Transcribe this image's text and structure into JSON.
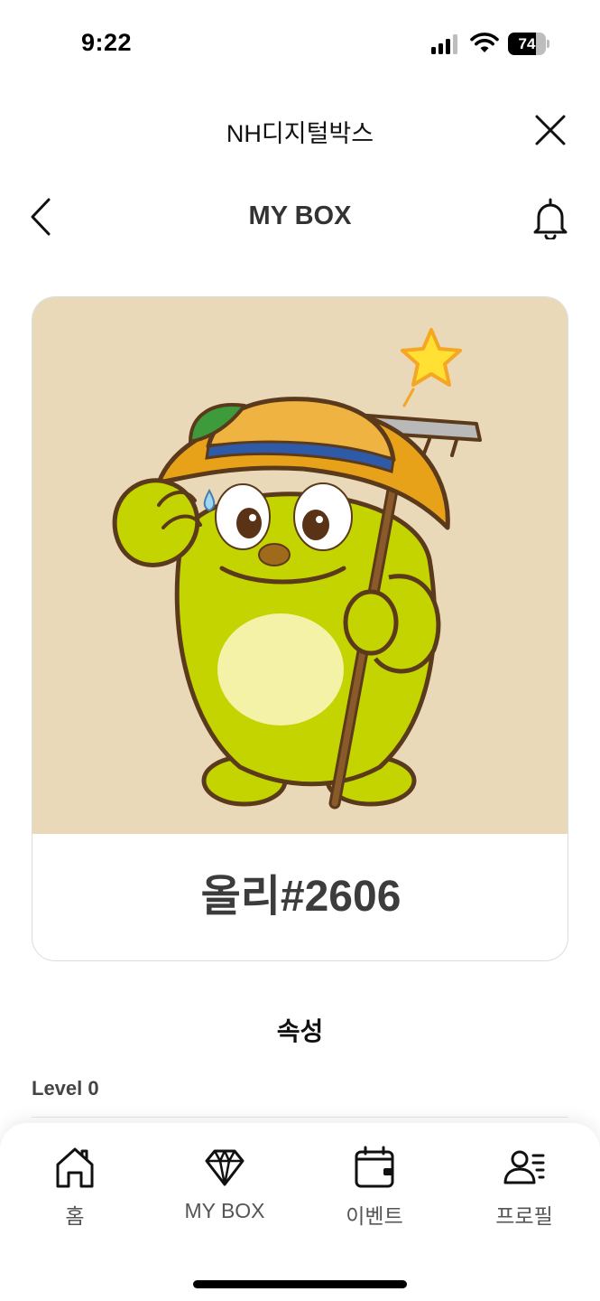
{
  "status_bar": {
    "time": "9:22",
    "battery": "74",
    "battery_level": 0.74,
    "icons": [
      "signal-icon",
      "wifi-icon",
      "battery-icon"
    ]
  },
  "browser_header": {
    "title": "NH디지털박스",
    "close_icon": "close-icon"
  },
  "page_header": {
    "title": "MY BOX",
    "back_icon": "chevron-left-icon",
    "notification_icon": "bell-icon"
  },
  "nft": {
    "name": "올리#2606",
    "image_background": "#e9d9b8",
    "image_description_icon": "olly-character-image"
  },
  "attributes": {
    "title": "속성",
    "level_label": "Level 0"
  },
  "bottom_nav": {
    "items": [
      {
        "label": "홈",
        "icon": "home-icon"
      },
      {
        "label": "MY BOX",
        "icon": "diamond-icon"
      },
      {
        "label": "이벤트",
        "icon": "calendar-icon"
      },
      {
        "label": "프로필",
        "icon": "profile-icon"
      }
    ]
  },
  "colors": {
    "accent_text": "#333333",
    "card_border": "#dcdcdc",
    "character_green": "#c4d400"
  }
}
